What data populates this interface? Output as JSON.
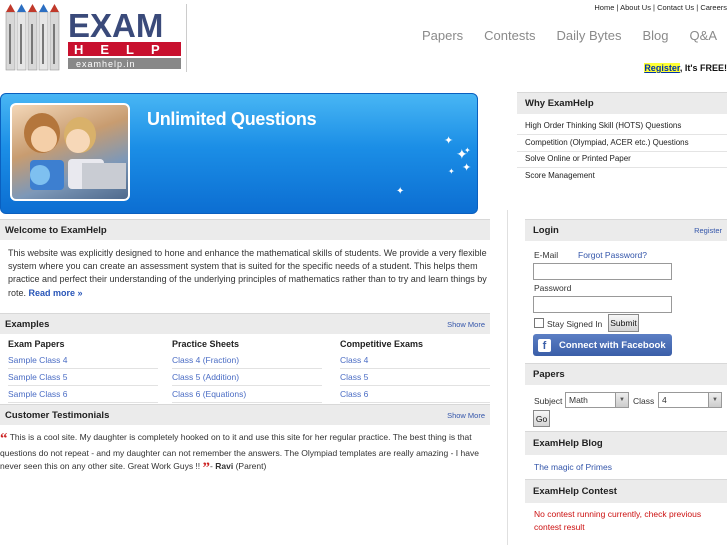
{
  "logo": {
    "word": "EXAM",
    "sub": "HELP",
    "url_text": "examhelp.in"
  },
  "toplinks": [
    "Home",
    "About Us",
    "Contact Us",
    "Careers"
  ],
  "nav": [
    "Papers",
    "Contests",
    "Daily Bytes",
    "Blog",
    "Q&A"
  ],
  "register_link": "Register",
  "register_rest": ", It's FREE!",
  "banner": {
    "title": "Unlimited Questions"
  },
  "welcome": {
    "title": "Welcome to ExamHelp",
    "body": "This website was explicitly designed to hone and enhance the mathematical skills of students. We provide a very flexible system where you can create an assessment system that is suited for the specific needs of a student. This helps them practice and perfect their understanding of the underlying principles of mathematics rather than to try and learn things by rote.",
    "read_more": "Read more »"
  },
  "examples": {
    "title": "Examples",
    "show_more": "Show More",
    "columns": [
      {
        "heading": "Exam Papers",
        "items": [
          "Sample Class 4",
          "Sample Class 5",
          "Sample Class 6"
        ]
      },
      {
        "heading": "Practice Sheets",
        "items": [
          "Class 4 (Fraction)",
          "Class 5 (Addition)",
          "Class 6 (Equations)"
        ]
      },
      {
        "heading": "Competitive Exams",
        "items": [
          "Class 4",
          "Class 5",
          "Class 6"
        ]
      }
    ]
  },
  "testimonials": {
    "title": "Customer Testimonials",
    "show_more": "Show More",
    "text": "This is a cool site. My daughter is completely hooked on to it and use this site for her regular practice. The best thing is that questions do not repeat - and my daughter can not remember the answers. The Olympiad templates are really amazing - I have never seen this on any other site. Great Work Guys !!",
    "author": "Ravi",
    "role": "(Parent)"
  },
  "why": {
    "title": "Why ExamHelp",
    "items": [
      "High Order Thinking Skill (HOTS) Questions",
      "Competition (Olympiad, ACER etc.) Questions",
      "Solve Online or Printed Paper",
      "Score Management"
    ]
  },
  "login": {
    "title": "Login",
    "register": "Register",
    "email_label": "E-Mail",
    "forgot": "Forgot Password?",
    "password_label": "Password",
    "stay": "Stay Signed In",
    "submit": "Submit",
    "facebook": "Connect with Facebook"
  },
  "papers": {
    "title": "Papers",
    "subject_label": "Subject",
    "subject_value": "Math",
    "class_label": "Class",
    "class_value": "4",
    "go": "Go"
  },
  "blog": {
    "title": "ExamHelp Blog",
    "link": "The magic of Primes"
  },
  "contest": {
    "title": "ExamHelp Contest",
    "message": "No contest running currently, check previous contest result"
  }
}
